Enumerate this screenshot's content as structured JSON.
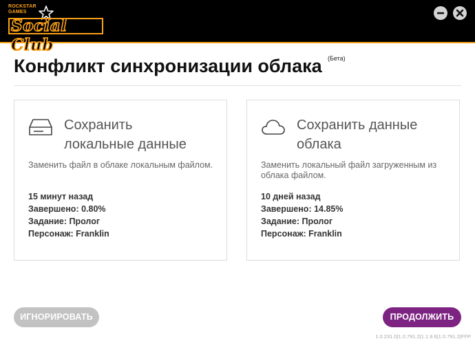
{
  "app": {
    "brand_small": "ROCKSTAR GAMES",
    "brand": "Social Club",
    "accent_color": "#fca218",
    "controls": [
      "minimize-icon",
      "close-icon"
    ]
  },
  "dialog": {
    "title": "Конфликт синхронизации облака",
    "badge": "(Бета)"
  },
  "options": [
    {
      "icon": "hard-drive-icon",
      "title_line1": "Сохранить",
      "title_line2": "локальные данные",
      "description": "Заменить файл в облаке локальным файлом.",
      "time": "15 минут назад",
      "completed": "Завершено: 0.80%",
      "mission": "Задание: Пролог",
      "character": "Персонаж: Franklin"
    },
    {
      "icon": "cloud-icon",
      "title_line1": "Сохранить данные",
      "title_line2": "облака",
      "description": "Заменить локальный файл загруженным из облака файлом.",
      "time": "10 дней назад",
      "completed": "Завершено: 14.85%",
      "mission": "Задание: Пролог",
      "character": "Персонаж: Franklin"
    }
  ],
  "buttons": {
    "ignore": "ИГНОРИРОВАТЬ",
    "continue": "ПРОДОЛЖИТЬ",
    "ignore_color": "#c2c2c2",
    "continue_color": "#7d2482"
  },
  "version": "1.0.231.0|1.0.791.2|1.1.9.6|1.0.791.2|FFP"
}
